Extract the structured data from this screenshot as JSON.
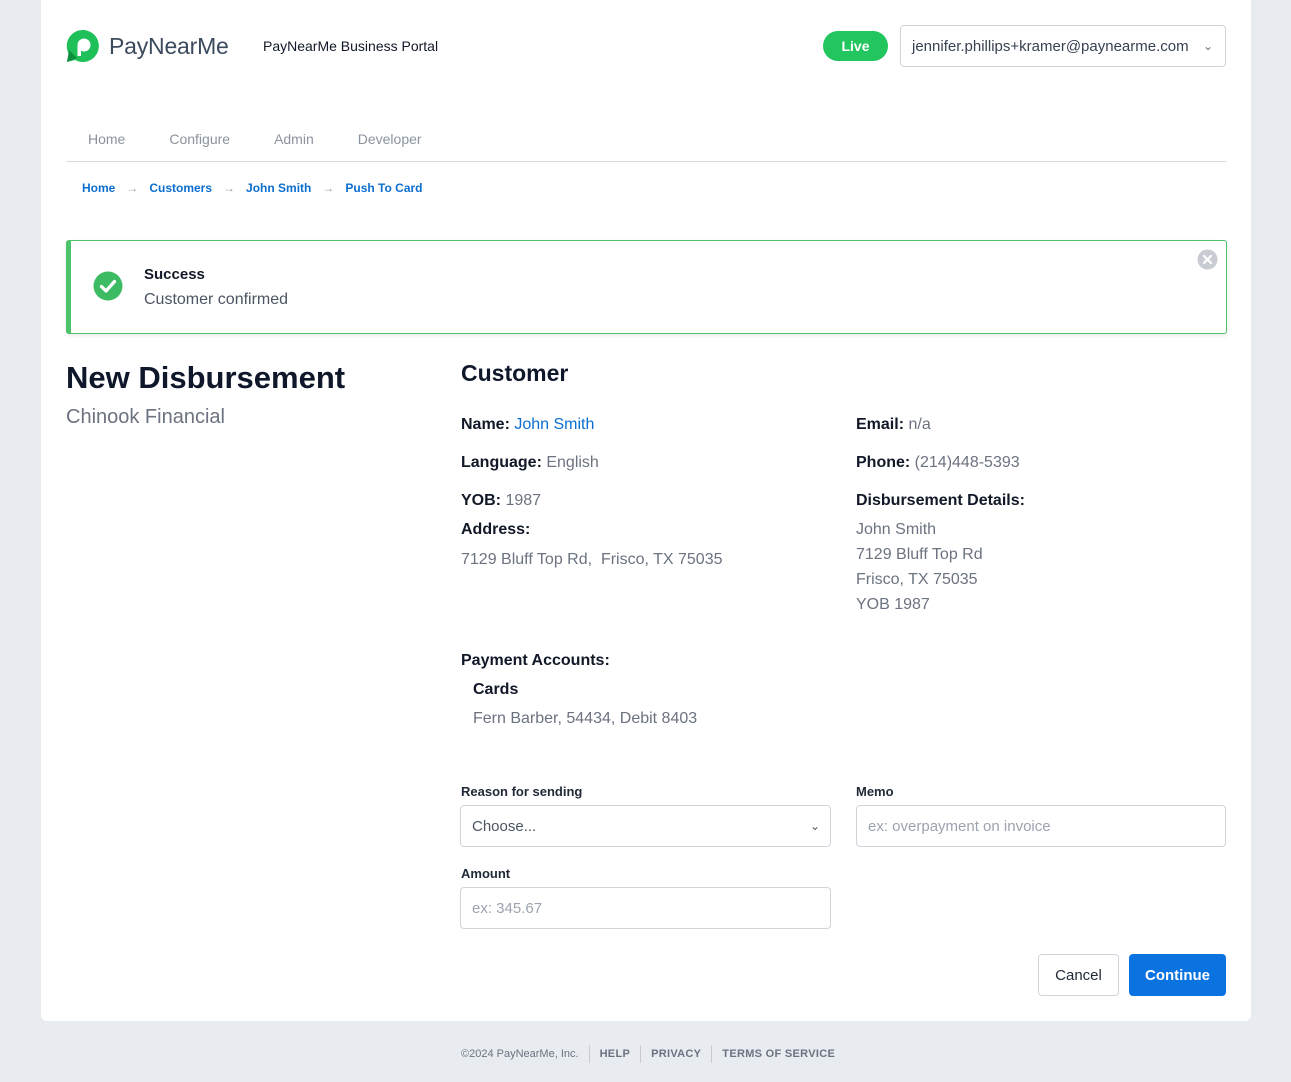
{
  "header": {
    "logo_text": "PayNearMe",
    "portal_title": "PayNearMe Business Portal",
    "env_badge": "Live",
    "account_email": "jennifer.phillips+kramer@paynearme.com"
  },
  "nav": {
    "items": [
      {
        "label": "Home"
      },
      {
        "label": "Configure"
      },
      {
        "label": "Admin"
      },
      {
        "label": "Developer"
      }
    ]
  },
  "breadcrumb": {
    "items": [
      "Home",
      "Customers",
      "John Smith",
      "Push To Card"
    ],
    "separator": "→"
  },
  "alert": {
    "title": "Success",
    "message": "Customer confirmed"
  },
  "page": {
    "title": "New Disbursement",
    "subtitle": "Chinook Financial"
  },
  "customer": {
    "section_title": "Customer",
    "name_label": "Name:",
    "name_value": "John Smith",
    "language_label": "Language:",
    "language_value": "English",
    "yob_label": "YOB:",
    "yob_value": "1987",
    "address_label": "Address:",
    "address_value": "7129 Bluff Top Rd,  Frisco, TX 75035",
    "email_label": "Email:",
    "email_value": "n/a",
    "phone_label": "Phone:",
    "phone_value": "(214)448-5393",
    "disbursement_label": "Disbursement Details:",
    "disbursement_lines": [
      "John Smith",
      "7129 Bluff Top Rd",
      "Frisco, TX 75035",
      "YOB 1987"
    ],
    "payment_accounts_label": "Payment Accounts:",
    "cards_label": "Cards",
    "card_value": "Fern Barber, 54434, Debit 8403"
  },
  "form": {
    "reason_label": "Reason for sending",
    "reason_value": "Choose...",
    "memo_label": "Memo",
    "memo_placeholder": "ex: overpayment on invoice",
    "amount_label": "Amount",
    "amount_placeholder": "ex: 345.67",
    "cancel_label": "Cancel",
    "continue_label": "Continue"
  },
  "footer": {
    "copyright": "©2024 PayNearMe, Inc.",
    "links": [
      "HELP",
      "PRIVACY",
      "TERMS OF SERVICE"
    ]
  },
  "colors": {
    "brand_green": "#22c55e",
    "link_blue": "#0b6ed0",
    "primary_button": "#0b73e0",
    "success_border": "#4cc46a"
  }
}
